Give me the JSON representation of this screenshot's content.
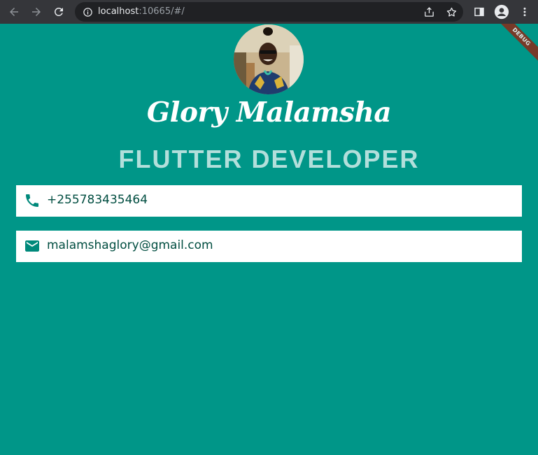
{
  "browser": {
    "url_host": "localhost",
    "url_rest": ":10665/#/",
    "icons": [
      "back-arrow-icon",
      "forward-arrow-icon",
      "reload-icon",
      "info-icon",
      "share-icon",
      "bookmark-star-icon",
      "side-panel-icon",
      "profile-icon",
      "kebab-menu-icon"
    ]
  },
  "profile": {
    "name": "Glory Malamsha",
    "title": "FLUTTER DEVELOPER"
  },
  "contacts": [
    {
      "icon": "phone-icon",
      "value": "+255783435464"
    },
    {
      "icon": "mail-icon",
      "value": "malamshaglory@gmail.com"
    }
  ],
  "debug_banner": "DEBUG",
  "colors": {
    "background": "#009688",
    "title_text": "#b2dfdb",
    "contact_text": "#004d40",
    "icon_color": "#00897b",
    "chrome_bar": "#35363a",
    "omnibox": "#202124"
  }
}
